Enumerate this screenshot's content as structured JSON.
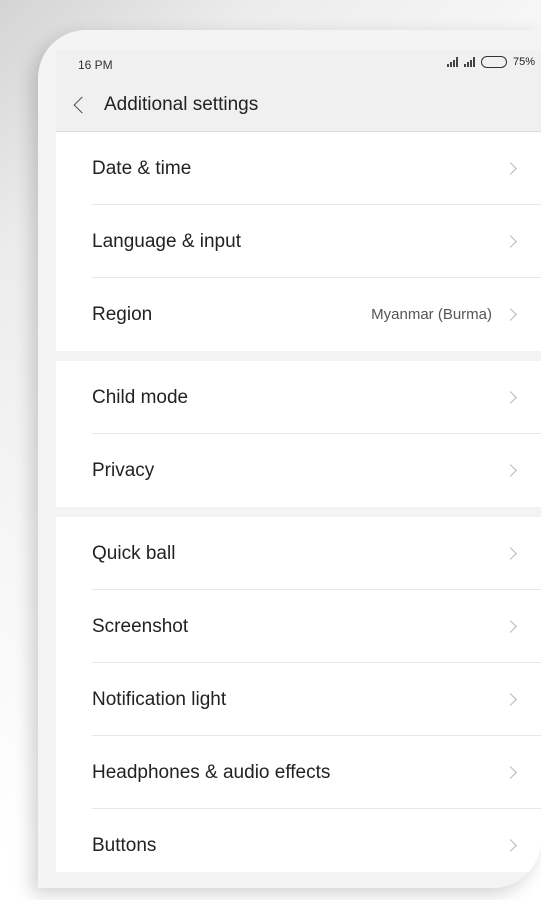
{
  "status": {
    "time": "16 PM",
    "battery": "75%",
    "battery_level": 0.75
  },
  "header": {
    "title": "Additional settings"
  },
  "groups": [
    {
      "items": [
        {
          "label": "Date & time",
          "value": ""
        },
        {
          "label": "Language & input",
          "value": ""
        },
        {
          "label": "Region",
          "value": "Myanmar (Burma)"
        }
      ]
    },
    {
      "items": [
        {
          "label": "Child mode",
          "value": ""
        },
        {
          "label": "Privacy",
          "value": ""
        }
      ]
    },
    {
      "items": [
        {
          "label": "Quick ball",
          "value": ""
        },
        {
          "label": "Screenshot",
          "value": ""
        },
        {
          "label": "Notification light",
          "value": ""
        },
        {
          "label": "Headphones & audio effects",
          "value": ""
        },
        {
          "label": "Buttons",
          "value": ""
        }
      ]
    }
  ]
}
